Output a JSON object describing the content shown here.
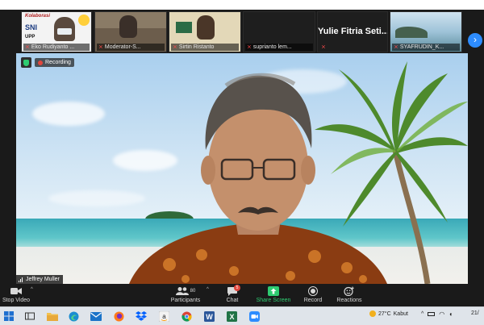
{
  "participant_strip": {
    "tiles": [
      {
        "name": "Eko Rudiyanto ...",
        "poster_lines": [
          "Kolaborasi",
          "SNI",
          "UPP"
        ]
      },
      {
        "name": "Moderator-S..."
      },
      {
        "name": "Sirtin Ristanto"
      },
      {
        "name": "suprianto lem..."
      },
      {
        "name": "",
        "big_name": "Yulie Fitria Seti..."
      },
      {
        "name": "SYAFRUDIN_K..."
      }
    ],
    "next_page_icon": "chevron-right-icon"
  },
  "main_video": {
    "recording_label": "Recording",
    "speaker_name": "Jeffrey Muller"
  },
  "toolbar": {
    "stop_video": "Stop Video",
    "participants": "Participants",
    "participants_count": "80",
    "chat": "Chat",
    "chat_badge": "5",
    "share_screen": "Share Screen",
    "record": "Record",
    "reactions": "Reactions",
    "accent_color": "#2ecc71"
  },
  "taskbar": {
    "apps": [
      "start-icon",
      "search-icon",
      "task-view-icon",
      "edge-icon",
      "mail-icon",
      "firefox-icon",
      "dropbox-icon",
      "amazon-icon",
      "chrome-icon",
      "word-icon",
      "excel-icon",
      "zoom-icon"
    ],
    "weather_temp": "27°C",
    "weather_text": "Kabut",
    "clock": "21/"
  }
}
